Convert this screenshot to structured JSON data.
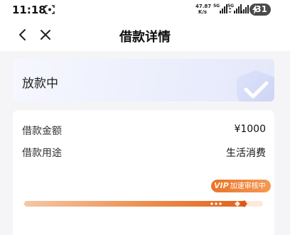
{
  "status_bar": {
    "time": "11:18",
    "net_speed_value": "47.87",
    "net_speed_unit": "K/s",
    "signal_1_label": "5G",
    "signal_2_label": "5G",
    "battery": "31"
  },
  "nav": {
    "title": "借款详情",
    "back_icon": "chevron-left-icon",
    "close_icon": "close-icon"
  },
  "status_card": {
    "label": "放款中",
    "icon": "checkmark-badge-icon"
  },
  "details": {
    "rows": [
      {
        "label": "借款金额",
        "value": "¥1000"
      },
      {
        "label": "借款用途",
        "value": "生活消费"
      }
    ]
  },
  "progress": {
    "badge_vip": "VIP",
    "badge_text": "加速审核中",
    "fraction": 0.93
  },
  "colors": {
    "accent": "#e8742c",
    "status_card_tint": "#e4e8fa"
  }
}
